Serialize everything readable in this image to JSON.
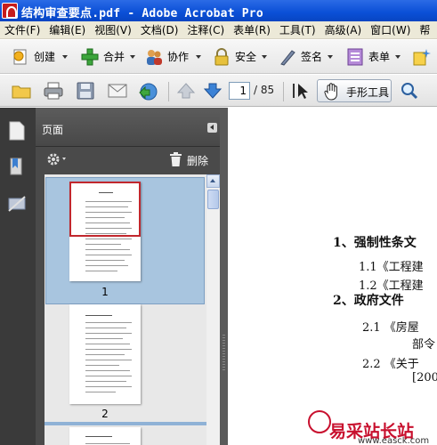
{
  "window": {
    "title": "结构审查要点.pdf - Adobe Acrobat Pro"
  },
  "menu": [
    "文件(F)",
    "编辑(E)",
    "视图(V)",
    "文档(D)",
    "注释(C)",
    "表单(R)",
    "工具(T)",
    "高级(A)",
    "窗口(W)",
    "帮"
  ],
  "toolbar1": {
    "create": "创建",
    "combine": "合并",
    "collaborate": "协作",
    "secure": "安全",
    "sign": "签名",
    "forms": "表单"
  },
  "toolbar2": {
    "current_page": "1",
    "total_pages": "/ 85",
    "hand_tool": "手形工具"
  },
  "panel": {
    "title": "页面",
    "delete": "删除",
    "thumbnails": [
      {
        "label": "1"
      },
      {
        "label": "2"
      }
    ]
  },
  "document": {
    "lines": [
      "1、强制性条文",
      "1.1《工程建",
      "1.2《工程建",
      "2、政府文件",
      "2.1 《房屋",
      "部令",
      "2.2 《关于",
      "[200"
    ]
  },
  "watermark": {
    "text": "易采站长站",
    "url": "www.easck.com"
  }
}
